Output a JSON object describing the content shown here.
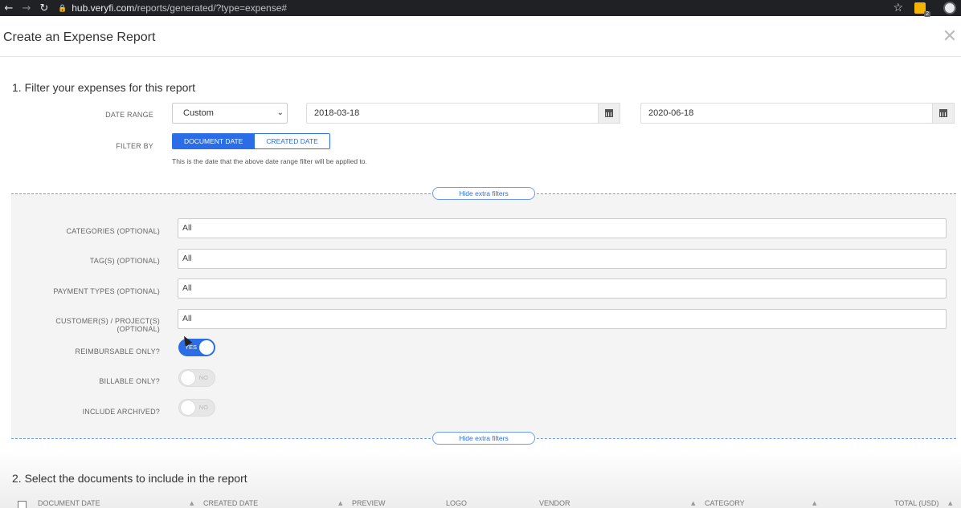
{
  "browser": {
    "url_host": "hub.veryfi.com",
    "url_path": "/reports/generated/?type=expense#",
    "extension_badge": "2"
  },
  "modal": {
    "title": "Create an Expense Report"
  },
  "section1": {
    "title": "1. Filter your expenses for this report",
    "date_range_label": "DATE RANGE",
    "date_range_select": "Custom",
    "start_date": "2018-03-18",
    "end_date": "2020-06-18",
    "filter_by_label": "FILTER BY",
    "filter_by_options": [
      "DOCUMENT DATE",
      "CREATED DATE"
    ],
    "filter_by_selected": "DOCUMENT DATE",
    "hint": "This is the date that the above date range filter will be applied to."
  },
  "extra_filters": {
    "toggle_label": "Hide extra filters",
    "fields": [
      {
        "label": "CATEGORIES (OPTIONAL)",
        "value": "All"
      },
      {
        "label": "TAG(S) (OPTIONAL)",
        "value": "All"
      },
      {
        "label": "PAYMENT TYPES (OPTIONAL)",
        "value": "All"
      },
      {
        "label": "CUSTOMER(S) / PROJECT(S) (OPTIONAL)",
        "value": "All"
      }
    ],
    "toggles": [
      {
        "label": "REIMBURSABLE ONLY?",
        "state": "YES",
        "on": true
      },
      {
        "label": "BILLABLE ONLY?",
        "state": "NO",
        "on": false
      },
      {
        "label": "INCLUDE ARCHIVED?",
        "state": "NO",
        "on": false
      }
    ]
  },
  "section2": {
    "title": "2. Select the documents to include in the report",
    "columns": [
      "DOCUMENT DATE",
      "CREATED DATE",
      "PREVIEW",
      "LOGO",
      "VENDOR",
      "CATEGORY",
      "TOTAL (USD)"
    ]
  },
  "colors": {
    "accent": "#2a6de6",
    "filter_area": "#f4f4f4"
  }
}
